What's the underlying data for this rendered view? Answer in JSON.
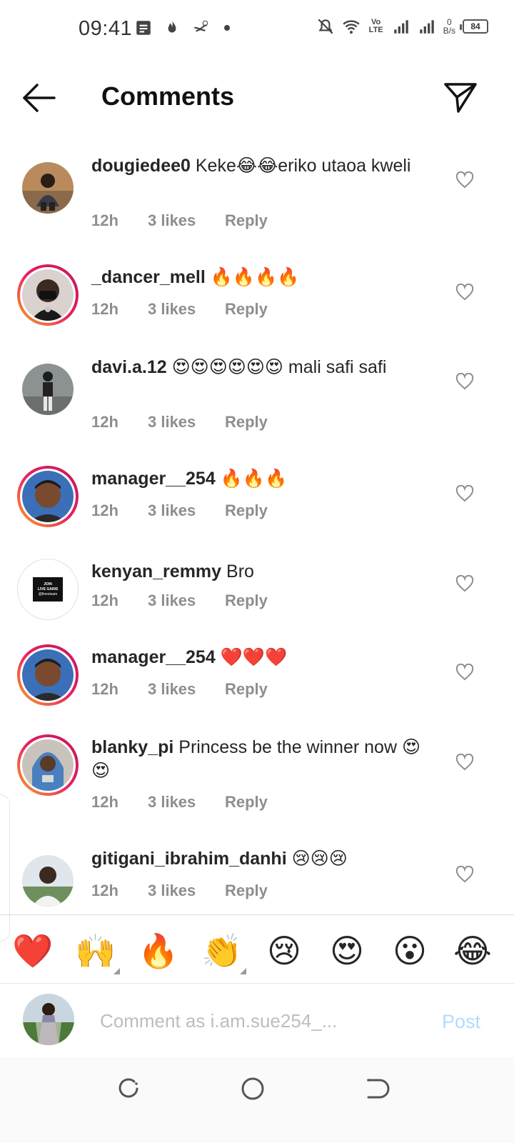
{
  "status_bar": {
    "time": "09:41",
    "network": "Vo LTE",
    "data_speed_value": "0",
    "data_speed_unit": "B/s",
    "battery": "84"
  },
  "header": {
    "title": "Comments"
  },
  "comments": [
    {
      "username": "dougiedee0",
      "text": "Keke😂😂eriko utaoa kweli",
      "time": "12h",
      "likes": "3 likes",
      "reply": "Reply"
    },
    {
      "username": "_dancer_mell",
      "text": "🔥🔥🔥🔥",
      "time": "12h",
      "likes": "3 likes",
      "reply": "Reply"
    },
    {
      "username": "davi.a.12",
      "text": "😍😍😍😍😍😍 mali safi safi",
      "time": "12h",
      "likes": "3 likes",
      "reply": "Reply"
    },
    {
      "username": "manager__254",
      "text": "🔥🔥🔥",
      "time": "12h",
      "likes": "3 likes",
      "reply": "Reply"
    },
    {
      "username": "kenyan_remmy",
      "text": "Bro",
      "time": "12h",
      "likes": "3 likes",
      "reply": "Reply",
      "avatar_text": [
        "JOIN",
        "LIVE GAINS",
        "@finestsam"
      ]
    },
    {
      "username": "manager__254",
      "text": "❤️❤️❤️",
      "time": "12h",
      "likes": "3 likes",
      "reply": "Reply"
    },
    {
      "username": "blanky_pi",
      "text": "Princess be the winner now 😍😍",
      "time": "12h",
      "likes": "3 likes",
      "reply": "Reply"
    },
    {
      "username": "gitigani_ibrahim_danhi",
      "text": "😢😢😢",
      "time": "12h",
      "likes": "3 likes",
      "reply": "Reply"
    }
  ],
  "emoji_bar": [
    "❤️",
    "🙌",
    "🔥",
    "👏",
    "😢",
    "😍",
    "😮",
    "😂"
  ],
  "composer": {
    "placeholder": "Comment as i.am.sue254_...",
    "post_label": "Post"
  },
  "colors": {
    "text": "#262626",
    "meta": "#8e8e8e",
    "post_disabled": "#b3dbff",
    "story_ring_start": "#f9a825",
    "story_ring_end": "#c2185b"
  }
}
